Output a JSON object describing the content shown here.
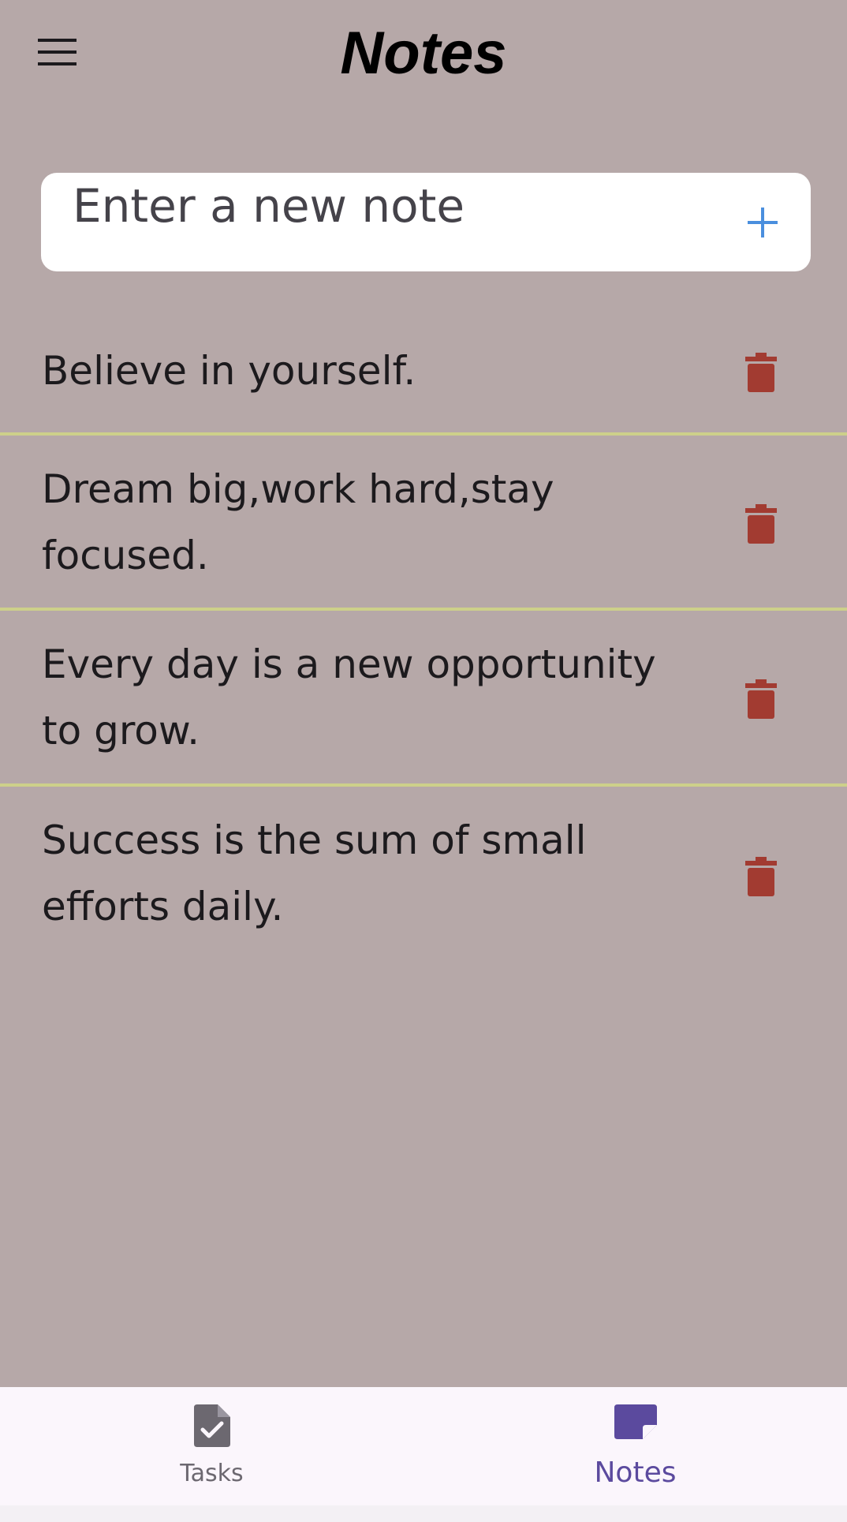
{
  "header": {
    "title": "Notes",
    "menu_icon": "hamburger-menu-icon"
  },
  "input": {
    "placeholder": "Enter a new note",
    "value": "",
    "add_icon": "plus-icon"
  },
  "notes": [
    {
      "text": "Believe in yourself."
    },
    {
      "text": "Dream big,work hard,stay focused."
    },
    {
      "text": "Every day is a new opportunity to grow."
    },
    {
      "text": "Success is the sum of small efforts daily."
    }
  ],
  "bottom_nav": {
    "items": [
      {
        "label": "Tasks",
        "icon": "task-file-check-icon",
        "active": false
      },
      {
        "label": "Notes",
        "icon": "note-icon",
        "active": true
      }
    ]
  },
  "colors": {
    "background": "#b6a8a8",
    "divider": "#cdd08a",
    "delete": "#a23b31",
    "accent_add": "#4a8fde",
    "nav_active": "#5b4a9e",
    "nav_inactive": "#6c6870",
    "nav_background": "#fbf6fc"
  }
}
